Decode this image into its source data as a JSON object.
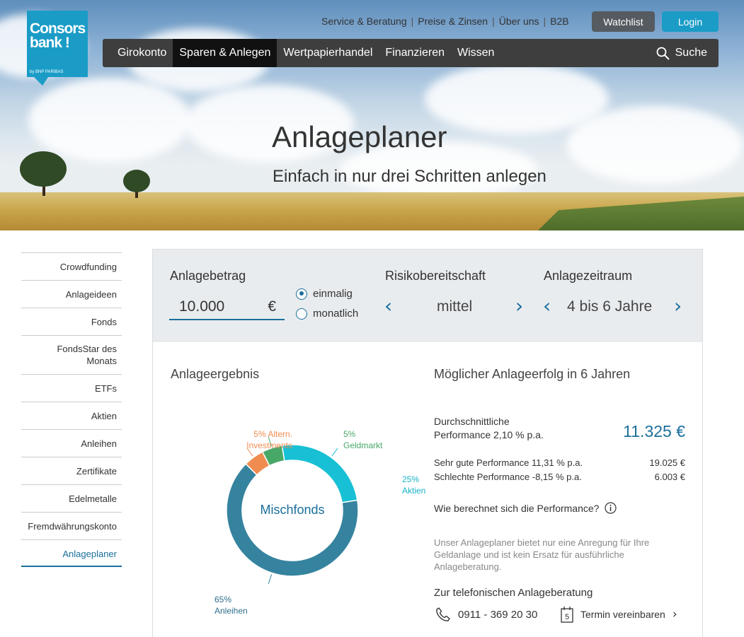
{
  "header": {
    "logo": {
      "line1": "Consors",
      "line2": "bank !",
      "sub": "by BNP PARIBAS"
    },
    "top_links": [
      "Service & Beratung",
      "Preise & Zinsen",
      "Über uns",
      "B2B"
    ],
    "separator": "|",
    "watchlist_label": "Watchlist",
    "login_label": "Login",
    "main_nav": [
      "Girokonto",
      "Sparen & Anlegen",
      "Wertpapierhandel",
      "Finanzieren",
      "Wissen"
    ],
    "active_nav": "Sparen & Anlegen",
    "search_label": "Suche"
  },
  "hero": {
    "title": "Anlageplaner",
    "subtitle": "Einfach in nur drei Schritten anlegen"
  },
  "sidebar": {
    "items": [
      "Crowdfunding",
      "Anlageideen",
      "Fonds",
      "FondsStar des Monats",
      "ETFs",
      "Aktien",
      "Anleihen",
      "Zertifikate",
      "Edelmetalle",
      "Fremdwährungskonto",
      "Anlageplaner"
    ],
    "active": "Anlageplaner"
  },
  "planner": {
    "amount_label": "Anlagebetrag",
    "amount_value": "10.000",
    "currency": "€",
    "option_once": "einmalig",
    "option_monthly": "monatlich",
    "selected_option": "einmalig",
    "risk_label": "Risikobereitschaft",
    "risk_value": "mittel",
    "period_label": "Anlagezeitraum",
    "period_value": "4 bis 6 Jahre"
  },
  "result": {
    "title": "Anlageergebnis",
    "center_label": "Mischfonds",
    "chart_data": {
      "type": "pie",
      "slices": [
        {
          "label": "Altern. Investments",
          "line1": "5% Altern.",
          "line2": "Investments",
          "value": 5,
          "color": "#f08c50"
        },
        {
          "label": "Geldmarkt",
          "line1": "5%",
          "line2": "Geldmarkt",
          "value": 5,
          "color": "#48a868"
        },
        {
          "label": "Aktien",
          "line1": "25%",
          "line2": "Aktien",
          "value": 25,
          "color": "#17c0d4"
        },
        {
          "label": "Anleihen",
          "line1": "65%",
          "line2": "Anleihen",
          "value": 65,
          "color": "#35839f"
        }
      ]
    }
  },
  "success": {
    "title": "Möglicher Anlageerfolg in 6 Jahren",
    "avg_line1": "Durchschnittliche",
    "avg_line2": "Performance 2,10 % p.a.",
    "avg_value": "11.325 €",
    "good_label": "Sehr gute Performance 11,31 % p.a.",
    "good_value": "19.025 €",
    "bad_label": "Schlechte Performance -8,15 % p.a.",
    "bad_value": "6.003 €",
    "how_label": "Wie berechnet sich die Performance?",
    "disclaimer_line1": "Unser Anlageplaner bietet nur eine Anregung für Ihre",
    "disclaimer_line2": "Geldanlage und ist kein Ersatz für ausführliche",
    "disclaimer_line3": "Anlageberatung.",
    "phone_title": "Zur telefonischen Anlageberatung",
    "phone": "0911 - 369 20 30",
    "appointment": "Termin vereinbaren",
    "calendar_day": "5"
  }
}
